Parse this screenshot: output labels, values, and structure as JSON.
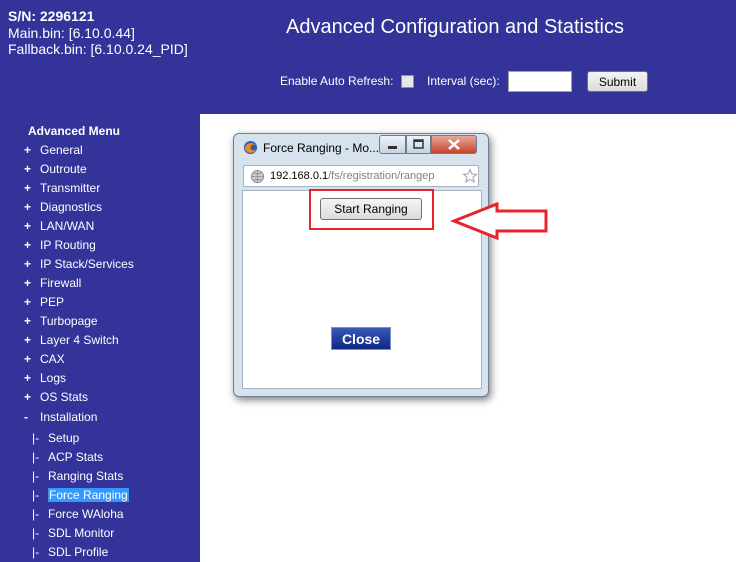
{
  "header": {
    "sn": "S/N: 2296121",
    "main_bin": "Main.bin: [6.10.0.44]",
    "fallback_bin": "Fallback.bin: [6.10.0.24_PID]",
    "title": "Advanced Configuration and Statistics",
    "auto_refresh_label": "Enable Auto Refresh:",
    "interval_label": "Interval (sec):",
    "interval_value": "",
    "submit_label": "Submit"
  },
  "sidebar": {
    "title": "Advanced Menu",
    "items": [
      {
        "marker": "+",
        "label": "General"
      },
      {
        "marker": "+",
        "label": "Outroute"
      },
      {
        "marker": "+",
        "label": "Transmitter"
      },
      {
        "marker": "+",
        "label": "Diagnostics"
      },
      {
        "marker": "+",
        "label": "LAN/WAN"
      },
      {
        "marker": "+",
        "label": "IP Routing"
      },
      {
        "marker": "+",
        "label": "IP Stack/Services"
      },
      {
        "marker": "+",
        "label": "Firewall"
      },
      {
        "marker": "+",
        "label": "PEP"
      },
      {
        "marker": "+",
        "label": "Turbopage"
      },
      {
        "marker": "+",
        "label": "Layer 4 Switch"
      },
      {
        "marker": "+",
        "label": "CAX"
      },
      {
        "marker": "+",
        "label": "Logs"
      },
      {
        "marker": "+",
        "label": "OS Stats"
      },
      {
        "marker": "-",
        "label": "Installation"
      }
    ],
    "sub_items": [
      {
        "marker": "|-",
        "label": "Setup"
      },
      {
        "marker": "|-",
        "label": "ACP Stats"
      },
      {
        "marker": "|-",
        "label": "Ranging Stats"
      },
      {
        "marker": "|-",
        "label": "Force Ranging",
        "selected": true
      },
      {
        "marker": "|-",
        "label": "Force WAloha"
      },
      {
        "marker": "|-",
        "label": "SDL Monitor"
      },
      {
        "marker": "|-",
        "label": "SDL Profile"
      }
    ]
  },
  "popup": {
    "title": "Force Ranging - Mo...",
    "url_host": "192.168.0.1",
    "url_path": "/fs/registration/rangep",
    "start_label": "Start Ranging",
    "close_label": "Close"
  },
  "colors": {
    "brand_blue": "#333399",
    "selection": "#3399ff",
    "annotation_red": "#e8242b"
  }
}
